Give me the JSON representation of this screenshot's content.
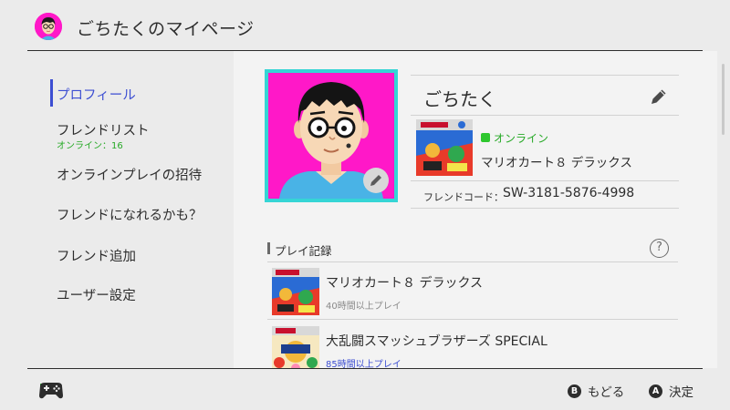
{
  "header": {
    "title": "ごちたくのマイページ",
    "avatar_color": "#ff18c8"
  },
  "sidebar": {
    "items": [
      {
        "label": "プロフィール",
        "active": true
      },
      {
        "label": "フレンドリスト",
        "sub": "オンライン：16"
      },
      {
        "label": "オンラインプレイの招待"
      },
      {
        "label": "フレンドになれるかも？"
      },
      {
        "label": "フレンド追加"
      },
      {
        "label": "ユーザー設定"
      }
    ]
  },
  "profile": {
    "username": "ごちたく",
    "status": "オンライン",
    "current_game": "マリオカート８ デラックス",
    "friend_code_label": "フレンドコード：",
    "friend_code": "SW-3181-5876-4998",
    "frame_color": "#35d5d5",
    "background_color": "#ff18c8"
  },
  "play_history": {
    "title": "プレイ記録",
    "help_icon_text": "?",
    "items": [
      {
        "title": "マリオカート８ デラックス",
        "time": "40時間以上プレイ"
      },
      {
        "title": "大乱闘スマッシュブラザーズ SPECIAL",
        "time": "85時間以上プレイ"
      }
    ]
  },
  "footer": {
    "back_button": "B",
    "back_label": "もどる",
    "confirm_button": "A",
    "confirm_label": "決定"
  },
  "colors": {
    "accent": "#3c4ed2",
    "online_green": "#26a926",
    "background": "#ebebeb"
  }
}
